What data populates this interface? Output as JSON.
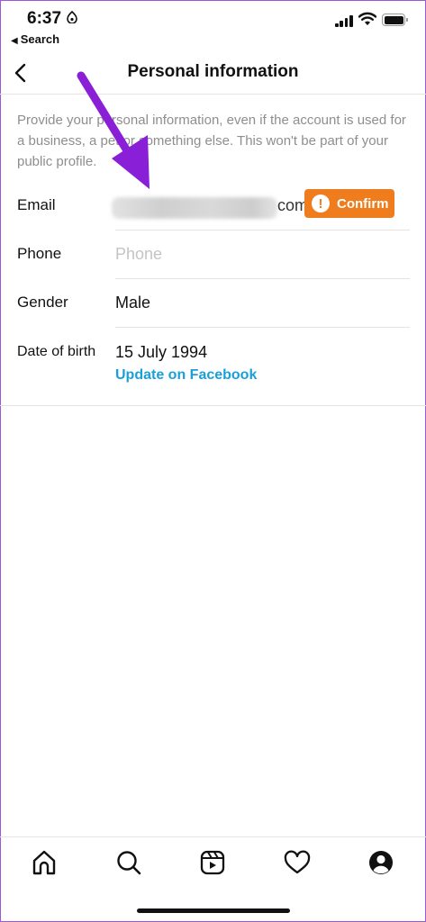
{
  "status_bar": {
    "time": "6:37",
    "back_label": "Search"
  },
  "header": {
    "title": "Personal information",
    "back_icon": "chevron-left-icon"
  },
  "description": "Provide your personal information, even if the account is used for a business, a pet or something else. This won't be part of your public profile.",
  "fields": {
    "email": {
      "label": "Email",
      "value_suffix": "com",
      "confirm_label": "Confirm",
      "confirm_color": "#f07d1d"
    },
    "phone": {
      "label": "Phone",
      "placeholder": "Phone",
      "value": ""
    },
    "gender": {
      "label": "Gender",
      "value": "Male"
    },
    "date_of_birth": {
      "label": "Date of birth",
      "value": "15 July 1994",
      "link_label": "Update on Facebook",
      "link_color": "#1aa0d8"
    }
  },
  "tab_bar": {
    "items": [
      {
        "name": "home",
        "icon": "home-icon"
      },
      {
        "name": "search",
        "icon": "search-icon"
      },
      {
        "name": "reels",
        "icon": "reels-icon"
      },
      {
        "name": "activity",
        "icon": "heart-icon"
      },
      {
        "name": "profile",
        "icon": "profile-icon"
      }
    ]
  },
  "annotation": {
    "arrow_color": "#8a1fd8"
  }
}
